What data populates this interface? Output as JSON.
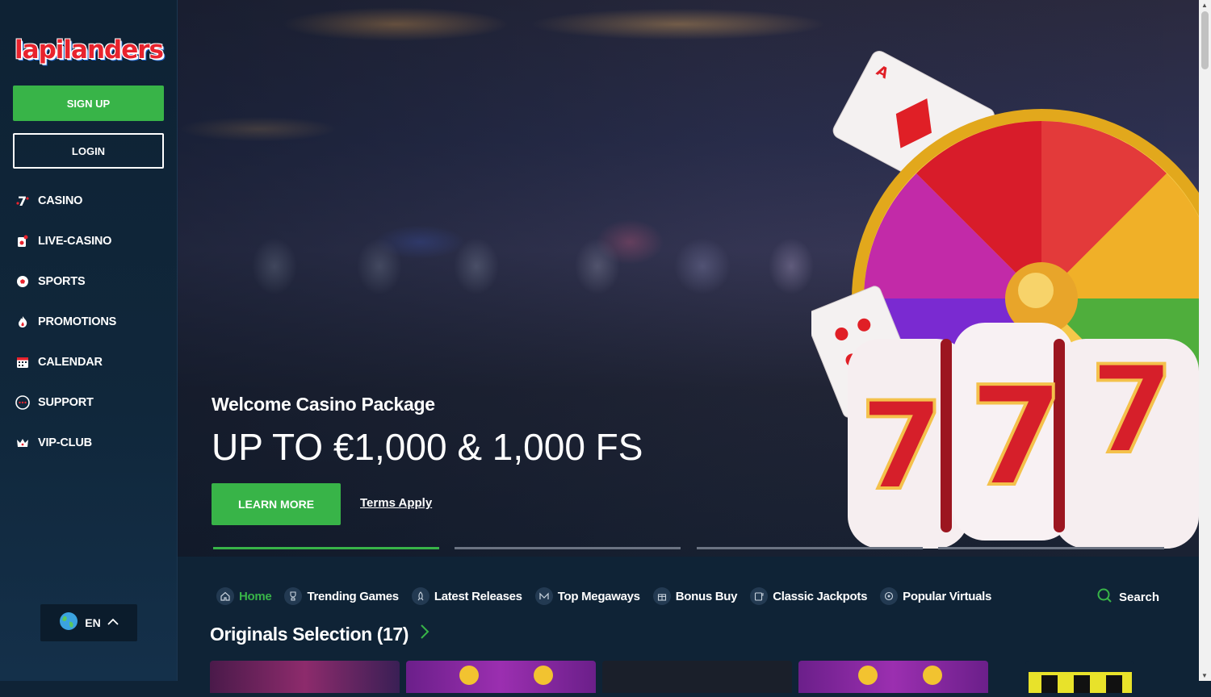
{
  "brand": {
    "logo_text": "lapilanders"
  },
  "sidebar": {
    "signup_label": "SIGN UP",
    "login_label": "LOGIN",
    "items": [
      {
        "label": "CASINO",
        "icon": "seven-icon"
      },
      {
        "label": "LIVE-CASINO",
        "icon": "live-card-icon"
      },
      {
        "label": "SPORTS",
        "icon": "soccer-ball-icon"
      },
      {
        "label": "PROMOTIONS",
        "icon": "flame-icon"
      },
      {
        "label": "CALENDAR",
        "icon": "calendar-icon"
      },
      {
        "label": "SUPPORT",
        "icon": "chat-icon"
      },
      {
        "label": "VIP-CLUB",
        "icon": "crown-icon"
      }
    ],
    "language": "EN"
  },
  "hero": {
    "subtitle": "Welcome Casino Package",
    "title": "UP TO €1,000 & 1,000 FS",
    "cta_label": "LEARN MORE",
    "terms_label": "Terms Apply",
    "slides_total": 4,
    "active_slide": 1
  },
  "categories": {
    "items": [
      {
        "label": "Home",
        "active": true
      },
      {
        "label": "Trending Games",
        "active": false
      },
      {
        "label": "Latest Releases",
        "active": false
      },
      {
        "label": "Top Megaways",
        "active": false
      },
      {
        "label": "Bonus Buy",
        "active": false
      },
      {
        "label": "Classic Jackpots",
        "active": false
      },
      {
        "label": "Popular Virtuals",
        "active": false
      }
    ],
    "search_label": "Search"
  },
  "section": {
    "title": "Originals Selection (17)"
  },
  "colors": {
    "accent": "#38b448",
    "sidebar_bg": "#0e2234",
    "page_bg": "#0f2336"
  }
}
